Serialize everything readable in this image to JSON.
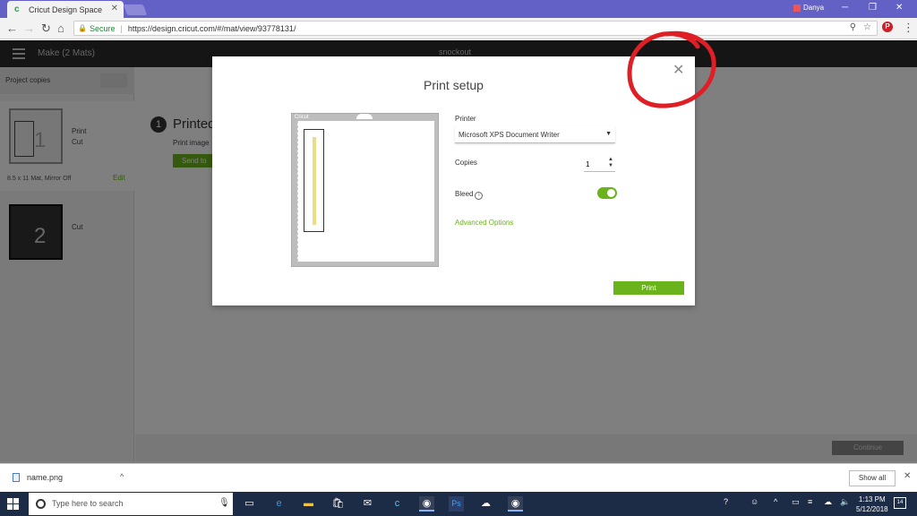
{
  "browser": {
    "tab_title": "Cricut Design Space",
    "profile_name": "Danya",
    "secure_label": "Secure",
    "url": "https://design.cricut.com/#/mat/view/93778131/"
  },
  "app": {
    "header_title": "Make (2 Mats)",
    "project_name": "snockout"
  },
  "left_panel": {
    "project_copies_label": "Project copies",
    "mats": [
      {
        "number": "1",
        "label1": "Print",
        "label2": "Cut",
        "meta": "8.5 x 11 Mat, Mirror Off",
        "edit": "Edit"
      },
      {
        "number": "2",
        "label1": "Cut"
      }
    ]
  },
  "main": {
    "step_number": "1",
    "step_title": "Printed",
    "step_sub": "Print image",
    "step_button": "Send to",
    "continue_label": "Continue"
  },
  "modal": {
    "title": "Print setup",
    "preview_brand": "Cricut",
    "printer_label": "Printer",
    "printer_value": "Microsoft XPS Document Writer",
    "copies_label": "Copies",
    "copies_value": "1",
    "bleed_label": "Bleed",
    "bleed_on": true,
    "advanced_options": "Advanced Options",
    "print_button": "Print"
  },
  "downloads": {
    "file_name": "name.png",
    "show_all": "Show all"
  },
  "taskbar": {
    "search_placeholder": "Type here to search",
    "time": "1:13 PM",
    "date": "5/12/2018",
    "notification_count": "14"
  },
  "colors": {
    "chrome_purple": "#6461c6",
    "cricut_green": "#6bb31c",
    "annotation_red": "#e01e26",
    "taskbar": "#1c2b46"
  }
}
